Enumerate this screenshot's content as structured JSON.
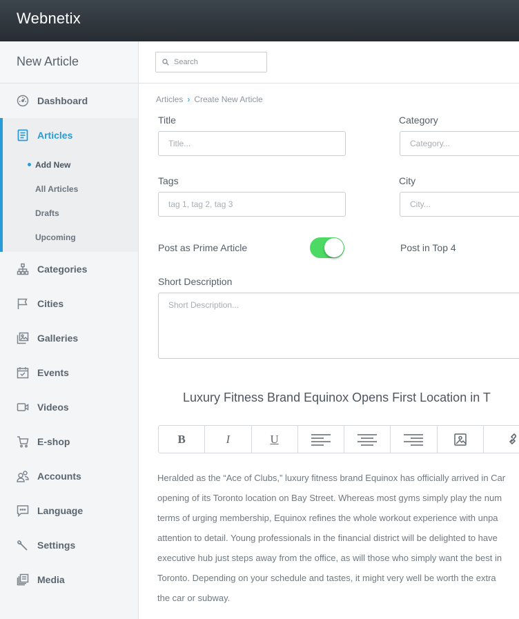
{
  "app": {
    "brand": "Webnetix"
  },
  "sidebar": {
    "title": "New Article",
    "items": [
      {
        "label": "Dashboard",
        "icon": "dashboard-icon"
      },
      {
        "label": "Articles",
        "icon": "document-icon",
        "active": true,
        "sub": [
          {
            "label": "Add New",
            "current": true
          },
          {
            "label": "All Articles"
          },
          {
            "label": "Drafts"
          },
          {
            "label": "Upcoming"
          }
        ]
      },
      {
        "label": "Categories",
        "icon": "hierarchy-icon"
      },
      {
        "label": "Cities",
        "icon": "flag-icon"
      },
      {
        "label": "Galleries",
        "icon": "gallery-icon"
      },
      {
        "label": "Events",
        "icon": "calendar-icon"
      },
      {
        "label": "Videos",
        "icon": "video-camera-icon"
      },
      {
        "label": "E-shop",
        "icon": "cart-icon"
      },
      {
        "label": "Accounts",
        "icon": "users-icon"
      },
      {
        "label": "Language",
        "icon": "chat-icon"
      },
      {
        "label": "Settings",
        "icon": "wrench-icon"
      },
      {
        "label": "Media",
        "icon": "media-icon"
      }
    ],
    "accent": "#2a9bd9"
  },
  "search": {
    "placeholder": "Search"
  },
  "breadcrumb": {
    "parent": "Articles",
    "current": "Create New Article"
  },
  "form": {
    "title_label": "Title",
    "title_placeholder": "Title...",
    "category_label": "Category",
    "category_placeholder": "Category...",
    "tags_label": "Tags",
    "tags_placeholder": "tag 1, tag 2, tag 3",
    "city_label": "City",
    "city_placeholder": "City...",
    "prime_label": "Post as Prime Article",
    "prime_on": true,
    "top4_label": "Post in Top 4",
    "short_desc_label": "Short Description",
    "short_desc_placeholder": "Short Description..."
  },
  "toggle_color": "#4cd964",
  "article": {
    "title": "Luxury Fitness Brand Equinox Opens First Location in T",
    "toolbar": [
      "B",
      "I",
      "U",
      "align-left-icon",
      "align-center-icon",
      "align-right-icon",
      "image-icon",
      "link-icon"
    ],
    "body_lines": [
      "Heralded as the “Ace of Clubs,” luxury fitness brand Equinox has officially arrived in Car",
      "opening of its Toronto location on Bay Street. Whereas most gyms simply play the num",
      "terms of urging membership, Equinox refines the whole workout experience with unpa",
      "attention to detail. Young professionals in the financial district will be delighted to have",
      "executive hub just steps away from the office, as will those who simply want the best in",
      "Toronto. Depending on your schedule and tastes, it might very well be worth the extra",
      "the car or subway."
    ]
  }
}
